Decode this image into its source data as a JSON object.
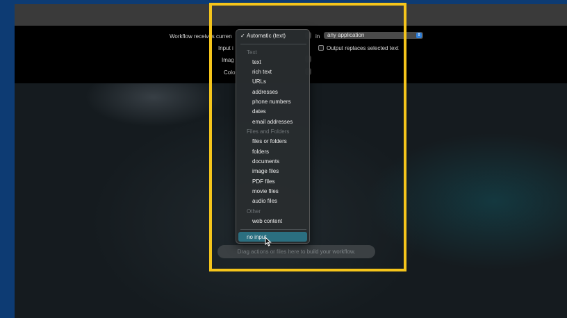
{
  "settings": {
    "workflow_receives_label": "Workflow receives curren",
    "input_label": "Input i",
    "image_label": "Imag",
    "color_label": "Colo",
    "in_label": "in",
    "application_value": "any application",
    "output_replaces_label": "Output replaces selected text"
  },
  "input_type_menu": {
    "selected": "Automatic (text)",
    "check": "✓",
    "groups": [
      {
        "header": "Text",
        "items": [
          "text",
          "rich text",
          "URLs",
          "addresses",
          "phone numbers",
          "dates",
          "email addresses"
        ]
      },
      {
        "header": "Files and Folders",
        "items": [
          "files or folders",
          "folders",
          "documents",
          "image files",
          "PDF files",
          "movie files",
          "audio files"
        ]
      },
      {
        "header": "Other",
        "items": [
          "web content"
        ]
      }
    ],
    "last_item": "no input"
  },
  "canvas": {
    "drop_hint": "Drag actions or files here to build your workflow."
  },
  "colors": {
    "page_background": "#0d3b73",
    "highlight_frame": "#f5c51b",
    "menu_selection": "#2b6f80",
    "select_arrow": "#2f7fd9"
  }
}
